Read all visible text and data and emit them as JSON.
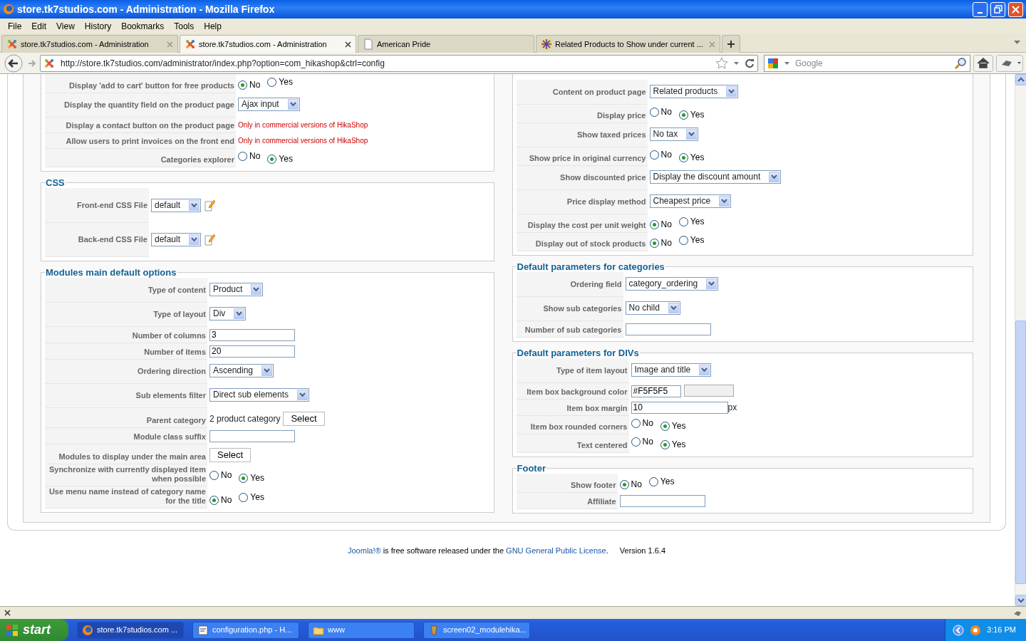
{
  "window": {
    "title": "store.tk7studios.com - Administration - Mozilla Firefox"
  },
  "menu": [
    "File",
    "Edit",
    "View",
    "History",
    "Bookmarks",
    "Tools",
    "Help"
  ],
  "tabs": [
    {
      "label": "store.tk7studios.com - Administration",
      "selected": false,
      "kind": "site"
    },
    {
      "label": "store.tk7studios.com - Administration",
      "selected": true,
      "kind": "site"
    },
    {
      "label": "American Pride",
      "selected": false,
      "kind": "page"
    },
    {
      "label": "Related Products to Show under current ...",
      "selected": false,
      "kind": "forum"
    }
  ],
  "address": {
    "url": "http://store.tk7studios.com/administrator/index.php?option=com_hikashop&ctrl=config"
  },
  "search": {
    "placeholder": "Google"
  },
  "left_sections": [
    {
      "rows": [
        {
          "label": "Display 'add to cart' button for free products",
          "kind": "radio",
          "options": [
            {
              "label": "No",
              "selected": true
            },
            {
              "label": "Yes",
              "selected": false
            }
          ]
        },
        {
          "label": "Display the quantity field on the product page",
          "kind": "select",
          "value": "Ajax input"
        },
        {
          "label": "Display a contact button on the product page",
          "kind": "note",
          "value": "Only in commercial versions of HikaShop"
        },
        {
          "label": "Allow users to print invoices on the front end",
          "kind": "note",
          "value": "Only in commercial versions of HikaShop"
        },
        {
          "label": "Categories explorer",
          "kind": "radio",
          "options": [
            {
              "label": "No",
              "selected": false
            },
            {
              "label": "Yes",
              "selected": true
            }
          ]
        }
      ]
    },
    {
      "title": "CSS",
      "rows": [
        {
          "label": "Front-end CSS File",
          "kind": "select_edit",
          "value": "default"
        },
        {
          "label": "Back-end CSS File",
          "kind": "select_edit",
          "value": "default"
        }
      ]
    },
    {
      "title": "Modules main default options",
      "rows": [
        {
          "label": "Type of content",
          "kind": "select",
          "value": "Product"
        },
        {
          "label": "Type of layout",
          "kind": "select",
          "value": "Div"
        },
        {
          "label": "Number of columns",
          "kind": "text",
          "value": "3"
        },
        {
          "label": "Number of items",
          "kind": "text",
          "value": "20"
        },
        {
          "label": "Ordering direction",
          "kind": "select",
          "value": "Ascending"
        },
        {
          "label": "Sub elements filter",
          "kind": "select",
          "value": "Direct sub elements"
        },
        {
          "label": "Parent category",
          "kind": "picker",
          "value": "2 product category",
          "button": "Select"
        },
        {
          "label": "Module class suffix",
          "kind": "text"
        },
        {
          "label": "Modules to display under the main area",
          "kind": "button",
          "button": "Select"
        },
        {
          "label": "Synchronize with currently displayed item when possible",
          "kind": "radio",
          "options": [
            {
              "label": "No",
              "selected": false
            },
            {
              "label": "Yes",
              "selected": true
            }
          ]
        },
        {
          "label": "Use menu name instead of category name for the title",
          "kind": "radio",
          "options": [
            {
              "label": "No",
              "selected": true
            },
            {
              "label": "Yes",
              "selected": false
            }
          ]
        }
      ]
    }
  ],
  "right_sections": [
    {
      "rows": [
        {
          "label": "Content on product page",
          "kind": "select",
          "value": "Related products"
        },
        {
          "label": "Display price",
          "kind": "radio",
          "options": [
            {
              "label": "No",
              "selected": false
            },
            {
              "label": "Yes",
              "selected": true
            }
          ]
        },
        {
          "label": "Show taxed prices",
          "kind": "select",
          "value": "No tax"
        },
        {
          "label": "Show price in original currency",
          "kind": "radio",
          "options": [
            {
              "label": "No",
              "selected": false
            },
            {
              "label": "Yes",
              "selected": true
            }
          ]
        },
        {
          "label": "Show discounted price",
          "kind": "select",
          "value": "Display the discount amount"
        },
        {
          "label": "Price display method",
          "kind": "select",
          "value": "Cheapest price"
        },
        {
          "label": "Display the cost per unit weight",
          "kind": "radio",
          "options": [
            {
              "label": "No",
              "selected": true
            },
            {
              "label": "Yes",
              "selected": false
            }
          ]
        },
        {
          "label": "Display out of stock products",
          "kind": "radio",
          "options": [
            {
              "label": "No",
              "selected": true
            },
            {
              "label": "Yes",
              "selected": false
            }
          ]
        }
      ]
    },
    {
      "title": "Default parameters for categories",
      "rows": [
        {
          "label": "Ordering field",
          "kind": "select",
          "value": "category_ordering"
        },
        {
          "label": "Show sub categories",
          "kind": "select",
          "value": "No child"
        },
        {
          "label": "Number of sub categories",
          "kind": "text"
        }
      ]
    },
    {
      "title": "Default parameters for DIVs",
      "rows": [
        {
          "label": "Type of item layout",
          "kind": "select",
          "value": "Image and title"
        },
        {
          "label": "Item box background color",
          "kind": "color",
          "value": "#F5F5F5",
          "color": "#f0f0f0"
        },
        {
          "label": "Item box margin",
          "kind": "text",
          "value": "10",
          "unit": "px"
        },
        {
          "label": "Item box rounded corners",
          "kind": "radio",
          "options": [
            {
              "label": "No",
              "selected": false
            },
            {
              "label": "Yes",
              "selected": true
            }
          ]
        },
        {
          "label": "Text centered",
          "kind": "radio",
          "options": [
            {
              "label": "No",
              "selected": false
            },
            {
              "label": "Yes",
              "selected": true
            }
          ]
        }
      ]
    },
    {
      "title": "Footer",
      "rows": [
        {
          "label": "Show footer",
          "kind": "radio",
          "options": [
            {
              "label": "No",
              "selected": true
            },
            {
              "label": "Yes",
              "selected": false
            }
          ]
        },
        {
          "label": "Affiliate",
          "kind": "text"
        }
      ]
    }
  ],
  "footer": {
    "license": [
      {
        "text": "Joomla!®",
        "kind": "link"
      },
      {
        "text": " is free software released under the ",
        "kind": "text"
      },
      {
        "text": "GNU General Public License",
        "kind": "link"
      },
      {
        "text": ".",
        "kind": "text"
      }
    ],
    "version": "Version 1.6.4"
  },
  "taskbar": {
    "start": "start",
    "items": [
      {
        "label": "store.tk7studios.com ...",
        "selected": true
      },
      {
        "label": "configuration.php - H...",
        "selected": false
      },
      {
        "label": "www",
        "selected": false
      },
      {
        "label": "screen02_modulehika...",
        "selected": false
      }
    ],
    "clock": "3:16 PM"
  }
}
